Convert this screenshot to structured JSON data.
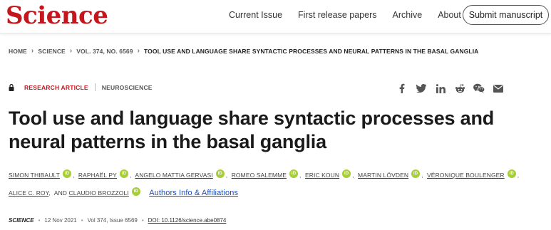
{
  "header": {
    "logo": "Science",
    "nav": [
      "Current Issue",
      "First release papers",
      "Archive"
    ],
    "about_label": "About",
    "submit_label": "Submit manuscript"
  },
  "breadcrumb": [
    "HOME",
    "SCIENCE",
    "VOL. 374, NO. 6569",
    "TOOL USE AND LANGUAGE SHARE SYNTACTIC PROCESSES AND NEURAL PATTERNS IN THE BASAL GANGLIA"
  ],
  "article": {
    "type": "RESEARCH ARTICLE",
    "subject": "NEUROSCIENCE",
    "title_line1": "Tool use and language share syntactic processes and",
    "title_line2": "neural patterns in the basal ganglia",
    "authors": [
      "SIMON THIBAULT",
      "RAPHAËL PY",
      "ANGELO MATTIA GERVASI",
      "ROMEO SALEMME",
      "ERIC KOUN",
      "MARTIN LÖVDEN",
      "VÉRONIQUE BOULENGER",
      "ALICE C. ROY",
      "AND",
      "CLAUDIO BROZZOLI"
    ],
    "orcid_label": "iD",
    "affiliations_link": "Authors Info & Affiliations",
    "journal": "SCIENCE",
    "date": "12 Nov 2021",
    "volume": "Vol 374, Issue 6569",
    "doi": "DOI: 10.1126/science.abe0874"
  },
  "share_icons": [
    "facebook-icon",
    "twitter-icon",
    "linkedin-icon",
    "reddit-icon",
    "wechat-icon",
    "email-icon"
  ],
  "colors": {
    "brand": "#c4161c",
    "orcid": "#a6ce39",
    "link": "#1a4fc0"
  }
}
